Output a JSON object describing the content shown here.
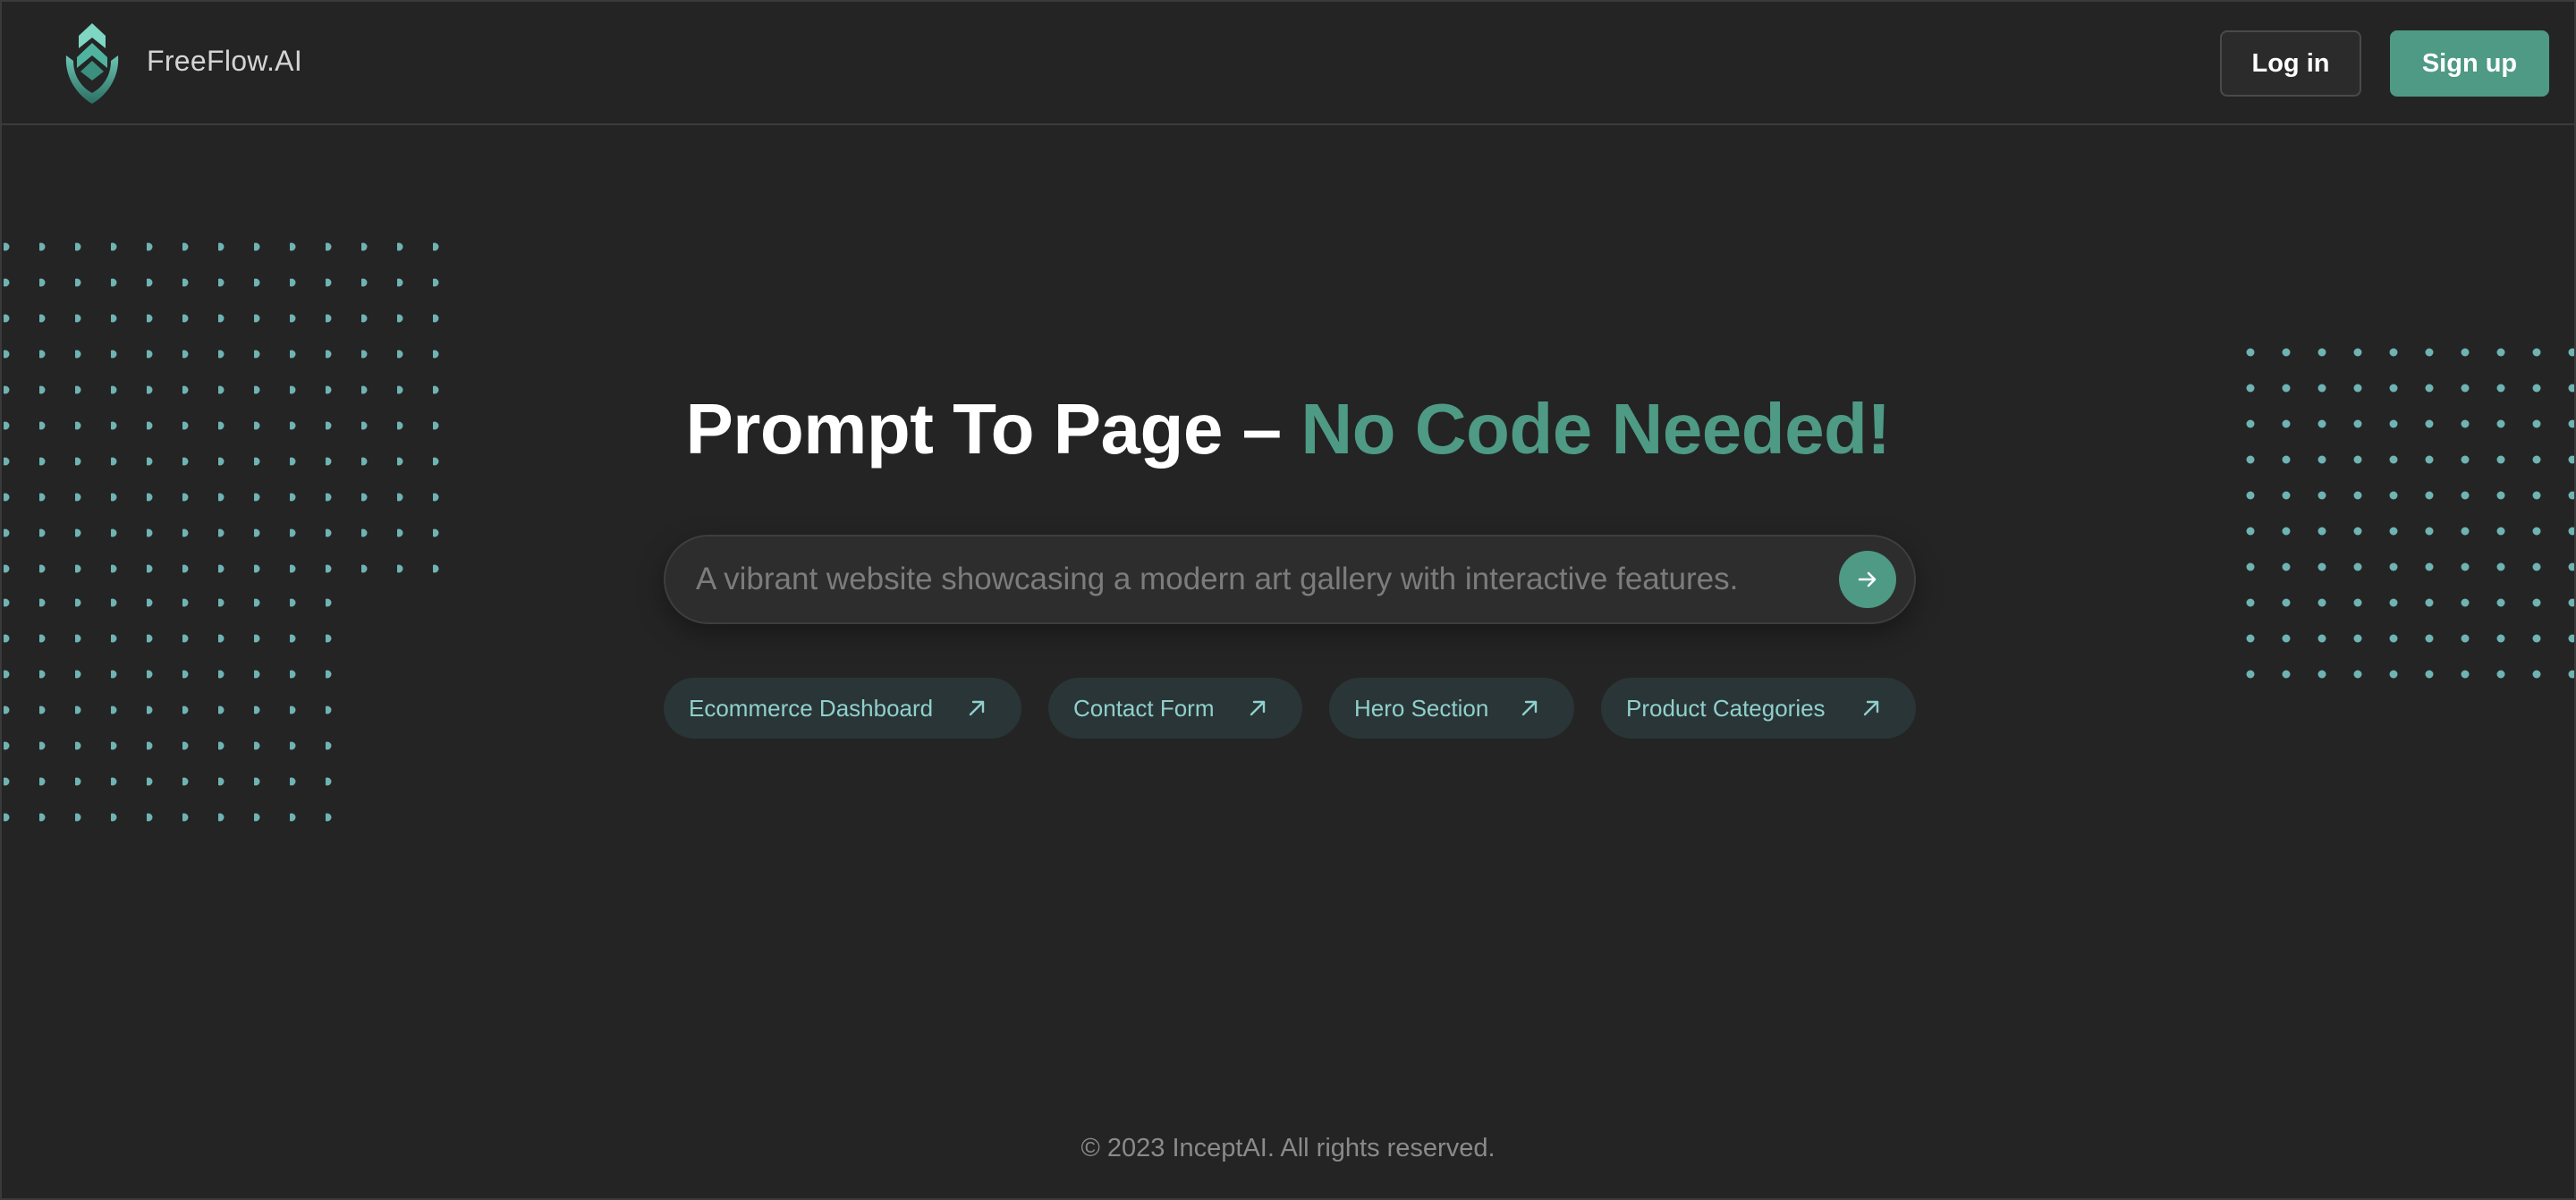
{
  "header": {
    "brand": "FreeFlow.AI",
    "login_label": "Log in",
    "signup_label": "Sign up",
    "logo_icon": "freeflow-leaf-logo"
  },
  "hero": {
    "headline_main": "Prompt To Page – ",
    "headline_accent": "No Code Needed!",
    "search_placeholder": "A vibrant website showcasing a modern art gallery with interactive features.",
    "search_value": "",
    "submit_icon": "arrow-right-icon"
  },
  "suggestions": [
    {
      "label": "Ecommerce Dashboard",
      "icon": "arrow-up-right-icon"
    },
    {
      "label": "Contact Form",
      "icon": "arrow-up-right-icon"
    },
    {
      "label": "Hero Section",
      "icon": "arrow-up-right-icon"
    },
    {
      "label": "Product Categories",
      "icon": "arrow-up-right-icon"
    }
  ],
  "footer": {
    "copyright": "© 2023 InceptAI. All rights reserved."
  },
  "colors": {
    "background": "#242424",
    "accent": "#4e9a84",
    "dot": "#6fb3b3",
    "chip_background": "#2a3537",
    "chip_text": "#8fd0cc"
  }
}
